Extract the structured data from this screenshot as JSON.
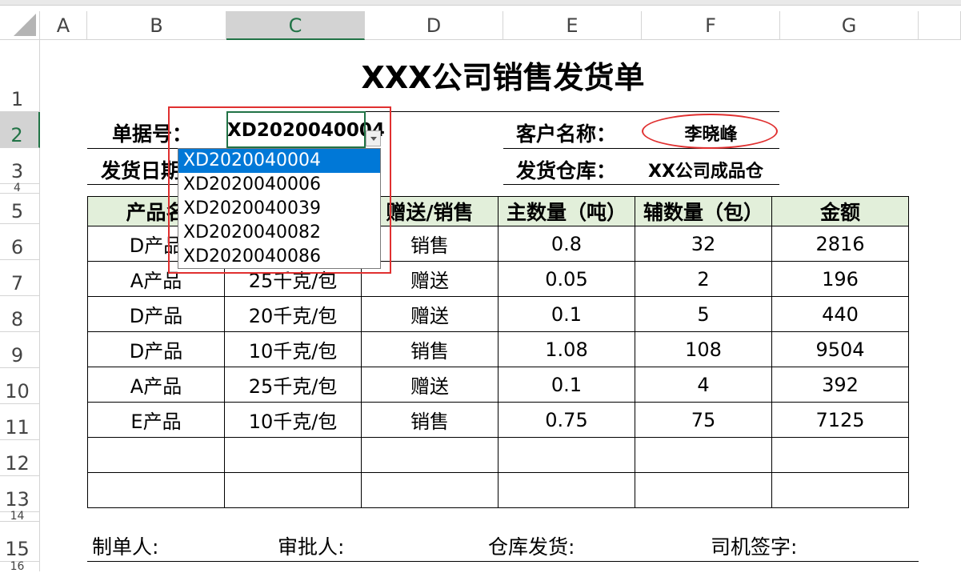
{
  "sheet": {
    "columns": [
      "A",
      "B",
      "C",
      "D",
      "E",
      "F",
      "G"
    ],
    "rows": [
      "1",
      "2",
      "3",
      "4",
      "5",
      "6",
      "7",
      "8",
      "9",
      "10",
      "11",
      "12",
      "13",
      "14",
      "15",
      "16"
    ],
    "selected_column": "C",
    "selected_row": "2"
  },
  "form": {
    "title": "XXX公司销售发货单",
    "doc_no_label": "单据号：",
    "doc_no_value": "XD2020040004",
    "ship_date_label": "发货日期",
    "customer_label": "客户名称：",
    "customer_value": "李晓峰",
    "warehouse_label": "发货仓库：",
    "warehouse_value": "XX公司成品仓"
  },
  "table": {
    "headers": [
      "产品名",
      "",
      "赠送/销售",
      "主数量（吨）",
      "辅数量（包）",
      "金额"
    ],
    "rows": [
      [
        "D产品",
        "",
        "销售",
        "0.8",
        "32",
        "2816"
      ],
      [
        "A产品",
        "25千克/包",
        "赠送",
        "0.05",
        "2",
        "196"
      ],
      [
        "D产品",
        "20千克/包",
        "赠送",
        "0.1",
        "5",
        "440"
      ],
      [
        "D产品",
        "10千克/包",
        "销售",
        "1.08",
        "108",
        "9504"
      ],
      [
        "A产品",
        "25千克/包",
        "赠送",
        "0.1",
        "4",
        "392"
      ],
      [
        "E产品",
        "10千克/包",
        "销售",
        "0.75",
        "75",
        "7125"
      ],
      [
        "",
        "",
        "",
        "",
        "",
        ""
      ],
      [
        "",
        "",
        "",
        "",
        "",
        ""
      ]
    ]
  },
  "signatures": {
    "maker": "制单人:",
    "approver": "审批人:",
    "warehouse": "仓库发货:",
    "driver": "司机签字:"
  },
  "dropdown": {
    "options": [
      "XD2020040004",
      "XD2020040006",
      "XD2020040039",
      "XD2020040082",
      "XD2020040086"
    ],
    "selected_index": 0
  },
  "colors": {
    "header_fill": "#e2efda",
    "selection_blue": "#0078d7",
    "annotation_red": "#e03030",
    "excel_green": "#217346"
  }
}
